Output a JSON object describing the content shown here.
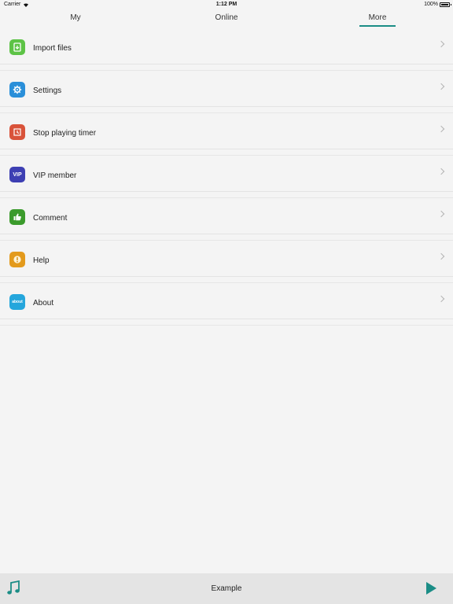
{
  "status": {
    "carrier": "Carrier",
    "time": "1:12 PM",
    "battery": "100%"
  },
  "tabs": [
    {
      "label": "My"
    },
    {
      "label": "Online"
    },
    {
      "label": "More",
      "active": true
    }
  ],
  "menu": {
    "items": [
      {
        "label": "Import files",
        "icon": "import-icon",
        "color": "#5dc346"
      },
      {
        "label": "Settings",
        "icon": "gear-icon",
        "color": "#2a8fd9"
      },
      {
        "label": "Stop playing timer",
        "icon": "timer-icon",
        "color": "#d9533a"
      },
      {
        "label": "VIP member",
        "icon": "vip-icon",
        "color": "#3d3fb3",
        "icon_text": "VIP"
      },
      {
        "label": "Comment",
        "icon": "thumbs-up-icon",
        "color": "#3b9b2c"
      },
      {
        "label": "Help",
        "icon": "help-icon",
        "color": "#e39a1c"
      },
      {
        "label": "About",
        "icon": "about-icon",
        "color": "#25a6dc",
        "icon_text": "about"
      }
    ]
  },
  "player": {
    "title": "Example",
    "accent": "#1b8d86"
  }
}
